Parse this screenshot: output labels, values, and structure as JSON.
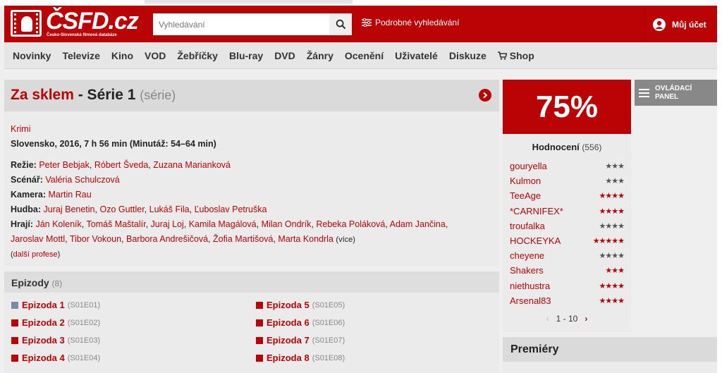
{
  "header": {
    "logo_text": "ČSFD.cz",
    "logo_tagline": "Česko-Slovenská filmová databáze",
    "search_placeholder": "Vyhledávání",
    "advanced_search": "Podrobné vyhledávání",
    "account": "Můj účet"
  },
  "nav": {
    "items": [
      "Novinky",
      "Televize",
      "Kino",
      "VOD",
      "Žebříčky",
      "Blu-ray",
      "DVD",
      "Žánry",
      "Ocenění",
      "Uživatelé",
      "Diskuze"
    ],
    "shop": "Shop"
  },
  "film": {
    "title": "Za sklem",
    "series": "- Série 1",
    "type": "(série)",
    "genre": "Krimi",
    "origin": "Slovensko, 2016, 7 h 56 min (Minutáž: 54–64 min)",
    "credits": [
      {
        "label": "Režie:",
        "people": [
          "Peter Bebjak",
          "Róbert Šveda",
          "Zuzana Marianková"
        ]
      },
      {
        "label": "Scénář:",
        "people": [
          "Valéria Schulczová"
        ]
      },
      {
        "label": "Kamera:",
        "people": [
          "Martin Rau"
        ]
      },
      {
        "label": "Hudba:",
        "people": [
          "Juraj Benetin",
          "Ozo Guttler",
          "Lukáš Fila",
          "Ľuboslav Petruška"
        ]
      }
    ],
    "cast_label": "Hrají:",
    "cast_line1": [
      "Ján Koleník",
      "Tomáš Maštalír",
      "Juraj Loj",
      "Kamila Magálová",
      "Milan Ondrík",
      "Rebeka Poláková",
      "Adam Jančina,"
    ],
    "cast_line2": [
      "Jaroslav Mottl",
      "Tibor Vokoun",
      "Barbora Andrešičová",
      "Žofia Martišová",
      "Marta Kondrla"
    ],
    "more": "(více)",
    "more_professions": "další profese"
  },
  "episodes": {
    "title": "Epizody",
    "count": "(8)",
    "items": [
      {
        "name": "Epizoda 1",
        "code": "(S01E01)"
      },
      {
        "name": "Epizoda 2",
        "code": "(S01E02)"
      },
      {
        "name": "Epizoda 3",
        "code": "(S01E03)"
      },
      {
        "name": "Epizoda 4",
        "code": "(S01E04)"
      },
      {
        "name": "Epizoda 5",
        "code": "(S01E05)"
      },
      {
        "name": "Epizoda 6",
        "code": "(S01E06)"
      },
      {
        "name": "Epizoda 7",
        "code": "(S01E07)"
      },
      {
        "name": "Epizoda 8",
        "code": "(S01E08)"
      }
    ]
  },
  "rating": {
    "score": "75%",
    "label": "Hodnocení",
    "count": "(556)",
    "users": [
      {
        "name": "gouryella",
        "stars": "★★★",
        "color": "#555555"
      },
      {
        "name": "Kulmon",
        "stars": "★★★",
        "color": "#555555"
      },
      {
        "name": "TeeAge",
        "stars": "★★★★",
        "color": "#ba0305"
      },
      {
        "name": "*CARNIFEX*",
        "stars": "★★★★",
        "color": "#ba0305"
      },
      {
        "name": "troufalka",
        "stars": "★★★★",
        "color": "#555555"
      },
      {
        "name": "HOCKEYKA",
        "stars": "★★★★★",
        "color": "#ba0305"
      },
      {
        "name": "cheyene",
        "stars": "★★★★",
        "color": "#555555"
      },
      {
        "name": "Shakers",
        "stars": "★★★",
        "color": "#ba0305"
      },
      {
        "name": "niethustra",
        "stars": "★★★★",
        "color": "#ba0305"
      },
      {
        "name": "Arsenal83",
        "stars": "★★★★",
        "color": "#ba0305"
      }
    ],
    "pager": "1 - 10"
  },
  "sidebar": {
    "panel_button_line1": "OVLÁDACÍ",
    "panel_button_line2": "PANEL",
    "premiery": "Premiéry"
  },
  "colors": {
    "accent": "#ba0305"
  }
}
